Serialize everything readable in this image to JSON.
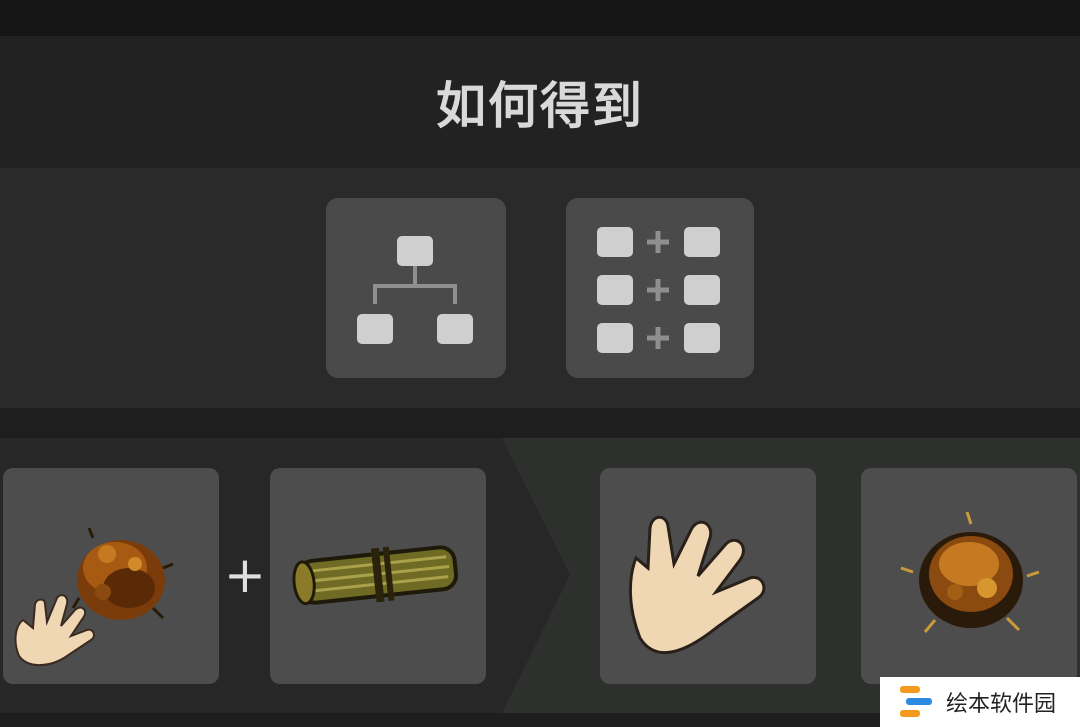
{
  "header": {
    "title": "如何得到"
  },
  "modes": [
    {
      "name": "tree-view",
      "icon": "tree-icon"
    },
    {
      "name": "grid-view",
      "icon": "recipe-grid-icon"
    }
  ],
  "recipe": {
    "ingredients": [
      {
        "item": "tinder-pile",
        "tool": "hand"
      },
      {
        "item": "reed-bundle"
      }
    ],
    "operator": "+",
    "results": [
      {
        "item": "hand"
      },
      {
        "item": "burning-tinder"
      }
    ]
  },
  "watermark": {
    "text": "绘本软件园"
  },
  "colors": {
    "background": "#1f1f1f",
    "panel": "#4d4d4d",
    "accent_result": "#2e302e",
    "title": "#d9d9d9"
  }
}
